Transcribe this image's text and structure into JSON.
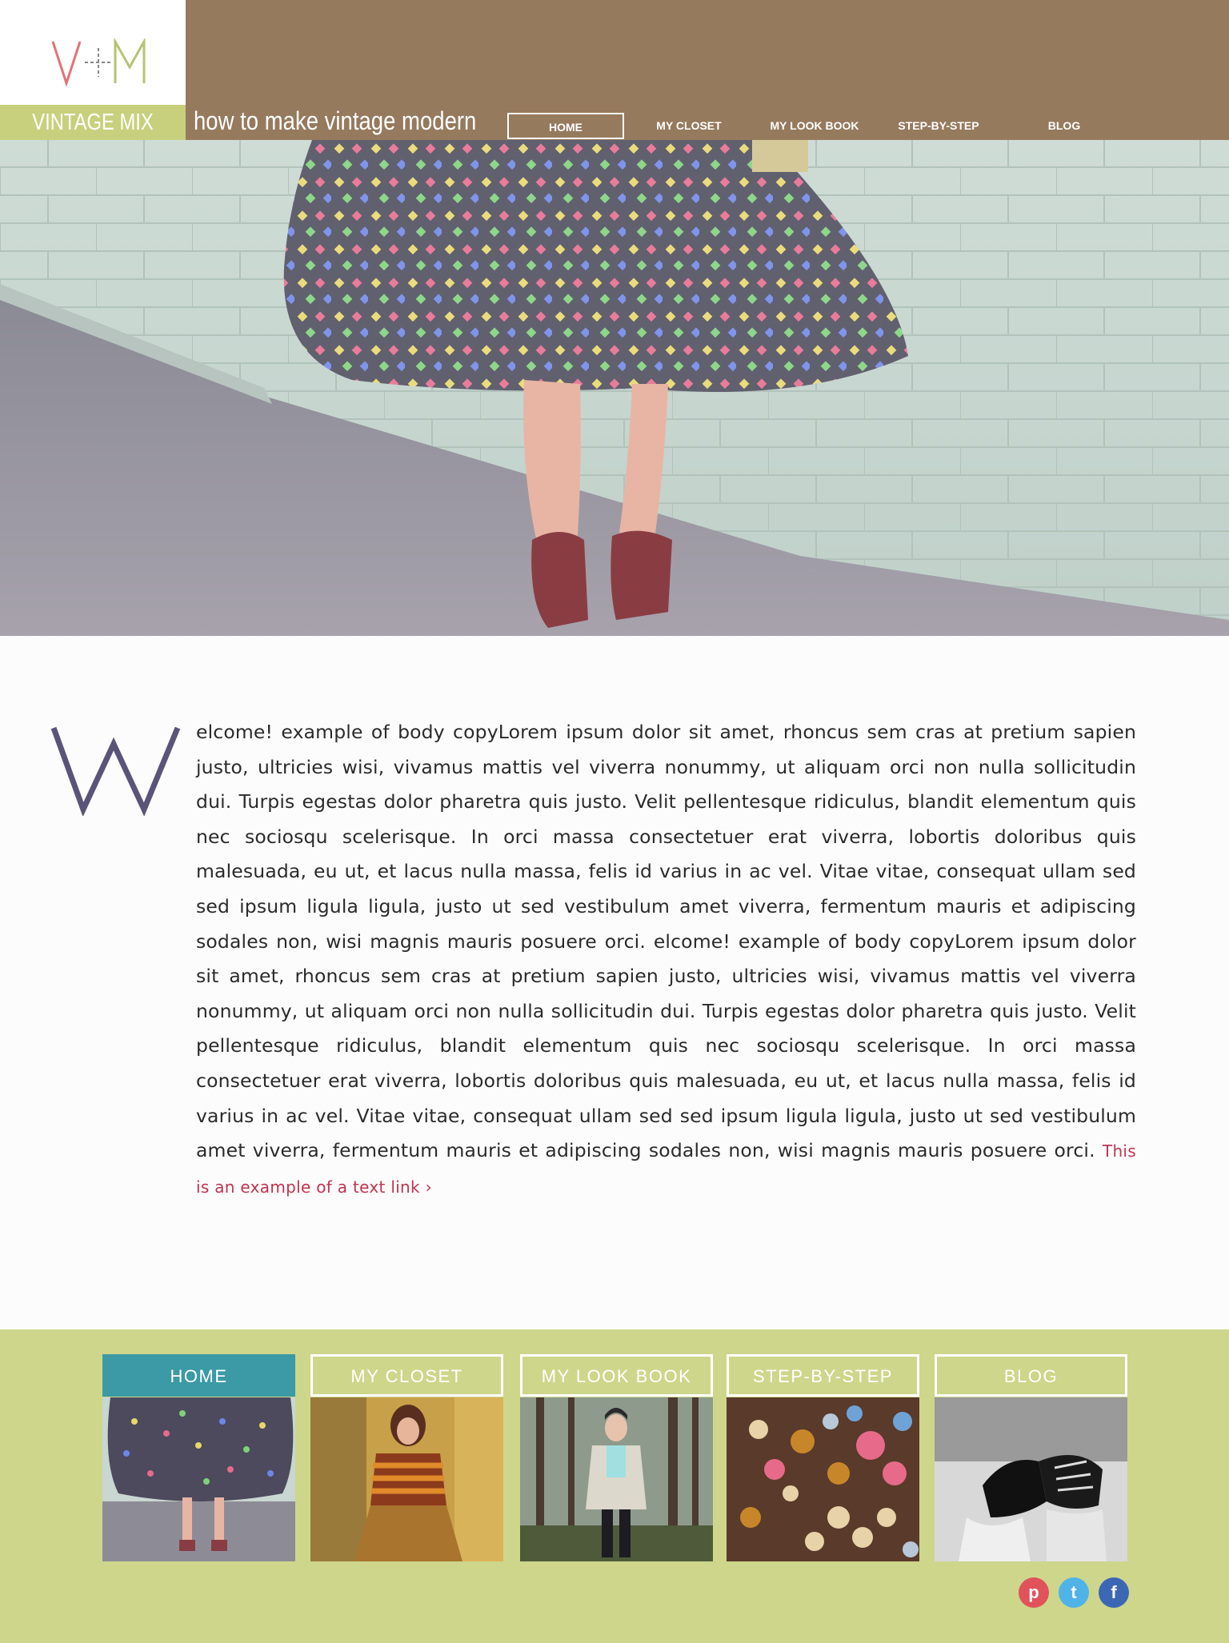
{
  "brand": {
    "logo_text": "V+M",
    "name": "VINTAGE MIX",
    "tagline": "how to make vintage modern"
  },
  "nav": {
    "items": [
      {
        "label": "HOME",
        "active": true
      },
      {
        "label": "MY CLOSET",
        "active": false
      },
      {
        "label": "MY LOOK BOOK",
        "active": false
      },
      {
        "label": "STEP-BY-STEP",
        "active": false
      },
      {
        "label": "BLOG",
        "active": false
      }
    ]
  },
  "hero": {
    "subject": "polka-dot skirt and red sandals photo"
  },
  "article": {
    "drop_cap": "W",
    "body": "elcome! example of body copyLorem ipsum dolor sit amet, rhoncus sem cras at pretium sapien justo, ultricies wisi, vivamus mattis vel viverra nonummy, ut aliquam orci non nulla sollicitudin dui. Turpis egestas dolor pharetra quis justo. Velit pellentesque ridiculus, blandit elementum quis nec sociosqu scelerisque. In orci massa consectetuer erat viverra, lobortis doloribus quis malesuada, eu ut, et lacus nulla massa, felis id varius in ac vel. Vitae vitae, consequat ullam sed sed ipsum ligula ligula, justo ut sed vestibulum amet viverra, fermentum mauris et adipiscing sodales non, wisi magnis mauris posuere orci. elcome! example of body copyLorem ipsum dolor sit amet, rhoncus sem cras at pretium sapien justo, ultricies wisi, vivamus mattis vel viverra nonummy, ut aliquam orci non nulla sollicitudin dui. Turpis egestas dolor pharetra quis justo. Velit pellentesque ridiculus, blandit elementum quis nec sociosqu scelerisque. In orci massa consectetuer erat viverra, lobortis doloribus quis malesuada, eu ut, et lacus nulla massa, felis id varius in ac vel. Vitae vitae, consequat ullam sed sed ipsum ligula ligula, justo ut sed vestibulum amet viverra, fermentum mauris et adipiscing sodales non, wisi magnis mauris posuere orci.",
    "link_text": "This is an example of a text link",
    "link_arrow": "›"
  },
  "footer": {
    "tiles": [
      {
        "label": "HOME",
        "active": true
      },
      {
        "label": "MY CLOSET",
        "active": false
      },
      {
        "label": "MY LOOK BOOK",
        "active": false
      },
      {
        "label": "STEP-BY-STEP",
        "active": false
      },
      {
        "label": "BLOG",
        "active": false
      }
    ],
    "social": [
      {
        "icon": "pinterest-icon",
        "glyph": "p",
        "color": "#e0535a"
      },
      {
        "icon": "twitter-icon",
        "glyph": "t",
        "color": "#4fb3e8"
      },
      {
        "icon": "facebook-icon",
        "glyph": "f",
        "color": "#3c67b5"
      }
    ]
  },
  "colors": {
    "header_brown": "#967a5e",
    "brand_green": "#c8d07e",
    "footer_green": "#cdd68b",
    "active_teal": "#3b9aa5",
    "link_red": "#c2334d",
    "dropcap_purple": "#5b5479"
  }
}
